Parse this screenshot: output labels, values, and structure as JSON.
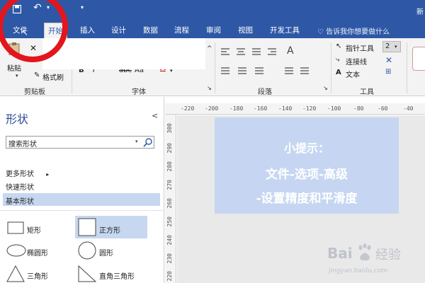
{
  "titlebar": {
    "save_icon": "save-icon",
    "undo_icon": "undo-icon",
    "right_text": "新"
  },
  "menu": {
    "tabs": [
      "文件",
      "开始",
      "插入",
      "设计",
      "数据",
      "流程",
      "审阅",
      "视图",
      "开发工具"
    ],
    "active_index": 1,
    "tell_me": "告诉我你想要做什么"
  },
  "ribbon": {
    "clipboard": {
      "paste": "粘贴",
      "format_painter": "格式刷",
      "group_label": "剪贴板"
    },
    "font": {
      "group_label": "字体",
      "bold": "B",
      "italic": "I",
      "strike": "abc",
      "size_label": "Aa",
      "color": "A"
    },
    "paragraph": {
      "group_label": "段落",
      "text_format": "A"
    },
    "tools": {
      "pointer": "指针工具",
      "connector": "连接线",
      "text": "文本",
      "group_label": "工具",
      "dropdown": "2"
    }
  },
  "pane": {
    "title": "形状",
    "search_placeholder": "搜索形状",
    "more_shapes": "更多形状",
    "quick_shapes": "快速形状",
    "basic_shapes": "基本形状",
    "shapes": [
      "矩形",
      "正方形",
      "椭圆形",
      "圆形",
      "三角形",
      "直角三角形"
    ]
  },
  "ruler": {
    "h_ticks": [
      "-220",
      "-200",
      "-180",
      "-160",
      "-140",
      "-120",
      "-100",
      "-80",
      "-60",
      "-40"
    ],
    "v_ticks": [
      "300",
      "290",
      "280",
      "270",
      "260",
      "250",
      "240",
      "230",
      "220"
    ]
  },
  "tip": {
    "title": "小提示：",
    "line1": "文件-选项-高级",
    "line2": "-设置精度和平滑度"
  },
  "watermark": {
    "brand_latin": "Bai",
    "brand_cn": "经验",
    "url": "jingyan.baidu.com"
  },
  "colors": {
    "ribbon_blue": "#2e58a6",
    "highlight_red": "#e2161c",
    "selected_blue": "#c7d7f0",
    "tip_bg": "#c6d6f2"
  }
}
